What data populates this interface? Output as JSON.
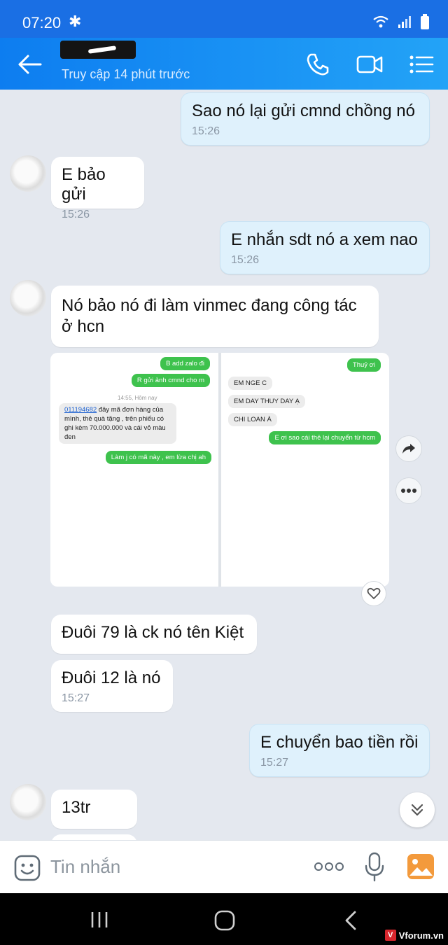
{
  "status": {
    "time": "07:20"
  },
  "header": {
    "last_seen": "Truy cập 14 phút trước"
  },
  "messages": [
    {
      "text": "Sao nó lại gửi cmnd chồng nó",
      "time": "15:26"
    },
    {
      "text": "E bảo gửi",
      "time": "15:26"
    },
    {
      "text": "E nhắn sdt nó a xem nao",
      "time": "15:26"
    },
    {
      "text": "Nó bảo nó đi làm vinmec đang công tác ở hcn"
    },
    {
      "text": "Đuôi 79 là ck nó tên Kiệt"
    },
    {
      "text": "Đuôi 12 là nó",
      "time": "15:27"
    },
    {
      "text": "E chuyển bao tiền rồi",
      "time": "15:27"
    },
    {
      "text": "13tr"
    }
  ],
  "photo_left": {
    "m1": "B add zalo đi",
    "m2": "R gửi ảnh cmnd cho m",
    "date": "14:55, Hôm nay",
    "m3_link": "011194682",
    "m3_text": " đây mã đơn hàng của mình, thẻ quà tặng , trên phiếu có ghi kèm 70.000.000 và cái vỏ màu đen",
    "m4": "Làm j có mã này , em lừa chị ah"
  },
  "photo_right": {
    "m1": "Thuỷ ơi",
    "m2": "EM NGE C",
    "m3": "EM DAY THUY DAY Ạ",
    "m4": "CHI LOAN À",
    "m5": "E ơi sao cái thẻ lại chuyển từ hcm"
  },
  "input": {
    "placeholder": "Tin nhắn"
  },
  "watermark": {
    "text": "Vforum.vn"
  },
  "colors": {
    "header": "#0d7df0",
    "outgoing": "#dff1fc",
    "incoming": "#ffffff",
    "background": "#e4e8ef"
  }
}
